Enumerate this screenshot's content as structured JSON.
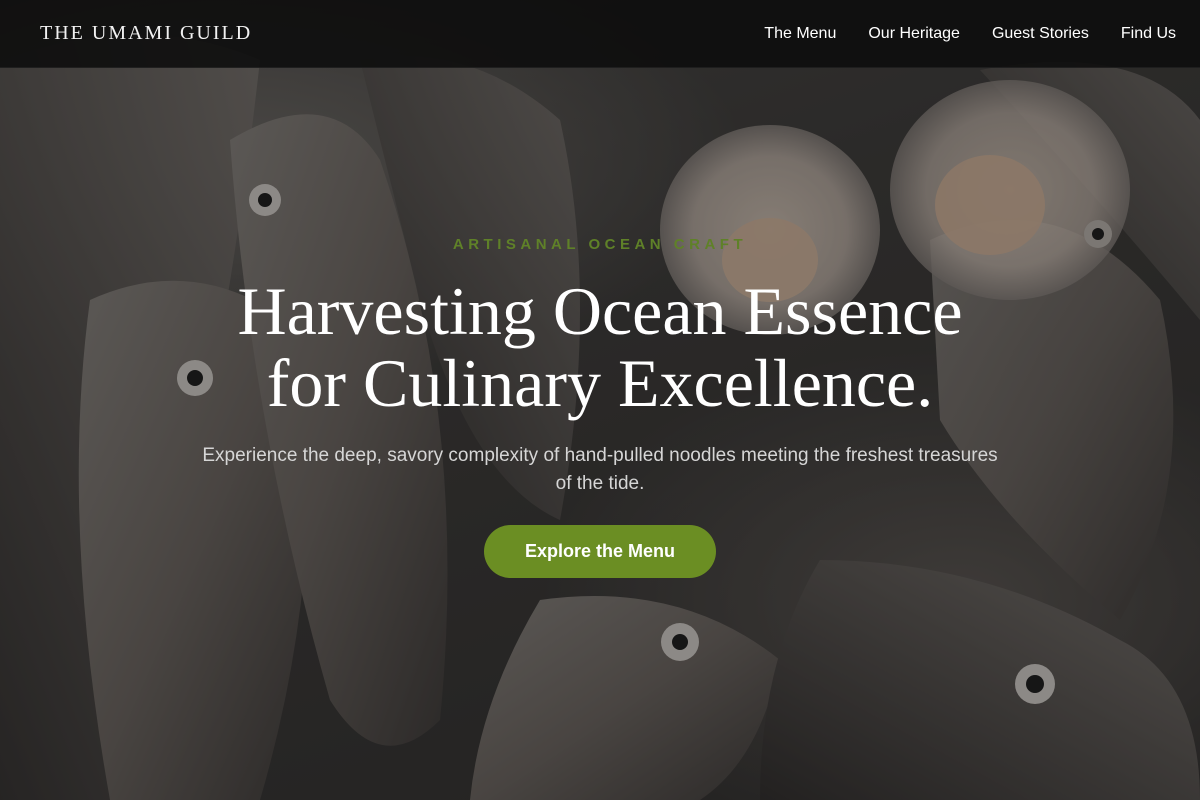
{
  "header": {
    "brand": "THE UMAMI GUILD",
    "nav": [
      {
        "label": "The Menu"
      },
      {
        "label": "Our Heritage"
      },
      {
        "label": "Guest Stories"
      },
      {
        "label": "Find Us"
      }
    ]
  },
  "hero": {
    "eyebrow": "ARTISANAL OCEAN CRAFT",
    "headline_line1": "Harvesting Ocean Essence",
    "headline_line2": "for Culinary Excellence.",
    "subtext": "Experience the deep, savory complexity of hand-pulled noodles meeting the freshest treasures of the tide.",
    "cta_label": "Explore the Menu",
    "background_subject": "fresh fish and scallops on ice"
  },
  "colors": {
    "accent": "#6b8e23",
    "eyebrow": "#5f8128",
    "header_bg": "#0c0c0c",
    "text_light": "#ffffff"
  }
}
